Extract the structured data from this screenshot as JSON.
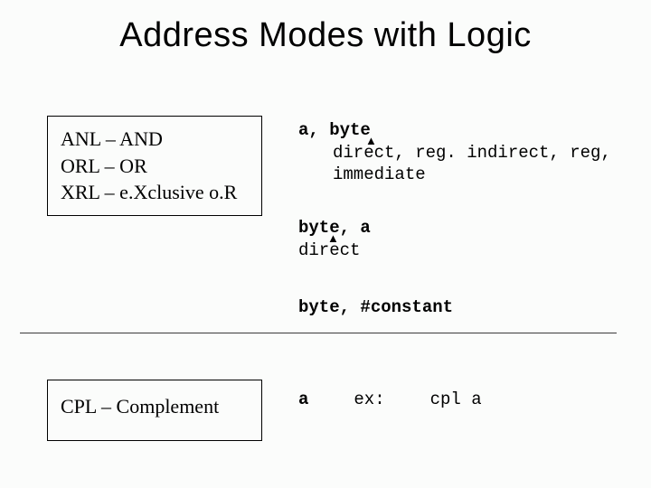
{
  "title": "Address Modes with Logic",
  "box1": {
    "line1": "ANL – AND",
    "line2": "ORL – OR",
    "line3": "XRL – e.Xclusive o.R"
  },
  "box2": {
    "line1": "CPL – Complement"
  },
  "right": {
    "r1_head": "a, byte",
    "r1_body": "direct, reg. indirect, reg, immediate",
    "r2_head": "byte, a",
    "r2_body": "direct",
    "r3": "byte, #constant",
    "r4_a": "a",
    "r4_ex": "ex:",
    "r4_cpl": "cpl a"
  }
}
